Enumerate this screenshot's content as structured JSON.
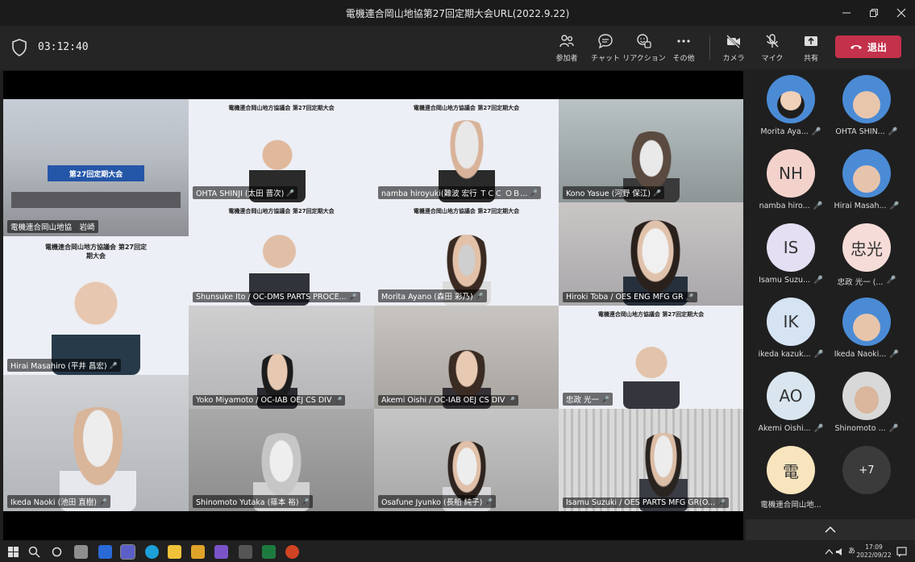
{
  "window": {
    "title": "電機連合岡山地協第27回定期大会URL(2022.9.22)"
  },
  "toolbar": {
    "timer": "03:12:40",
    "buttons": {
      "participants": "参加者",
      "chat": "チャット",
      "reactions": "リアクション",
      "more": "その他",
      "camera": "カメラ",
      "mic": "マイク",
      "share": "共有"
    },
    "leave_label": "退出",
    "leave_color": "#c4314b"
  },
  "tiles": [
    {
      "name": "電機連合岡山地協　岩崎",
      "slide": ""
    },
    {
      "name": "OHTA SHINJI (太田 晋次)",
      "slide": "電機連合岡山地方協議会 第27回定期大会"
    },
    {
      "name": "namba hiroyuki(難波 宏行 ＴＣＣ ＯＢ...",
      "slide": "電機連合岡山地方協議会 第27回定期大会"
    },
    {
      "name": "Kono Yasue (河野 保江)",
      "slide": ""
    },
    {
      "name": "Hirai Masahiro (平井 昌宏)",
      "slide": "電機連合岡山地方協議会 第27回定期大会"
    },
    {
      "name": "Shunsuke Ito / OC-DMS PARTS PROCE...",
      "slide": "電機連合岡山地方協議会 第27回定期大会"
    },
    {
      "name": "Morita Ayano (森田 彩乃)",
      "slide": "電機連合岡山地方協議会 第27回定期大会"
    },
    {
      "name": "Hiroki Toba / OES ENG MFG GR",
      "slide": ""
    },
    {
      "name": "Yoko Miyamoto / OC-IAB OEJ CS DIV",
      "slide": ""
    },
    {
      "name": "Akemi Oishi / OC-IAB OEJ CS DIV",
      "slide": ""
    },
    {
      "name": "忠政 光一",
      "slide": "電機連合岡山地方協議会 第27回定期大会"
    },
    {
      "name": "Ikeda Naoki (池田 直樹)",
      "slide": ""
    },
    {
      "name": "Shinomoto Yutaka (篠本 裕)",
      "slide": ""
    },
    {
      "name": "Osafune Jyunko (長船 純子)",
      "slide": ""
    },
    {
      "name": "Isamu Suzuki / OES PARTS MFG GR(O...",
      "slide": ""
    }
  ],
  "stage_banner": "第27回定期大会",
  "participants": [
    {
      "name": "Morita Aya...",
      "initials": "",
      "color": "#4b8bd6",
      "photo": true
    },
    {
      "name": "OHTA SHIN...",
      "initials": "",
      "color": "#4b8bd6",
      "photo": true
    },
    {
      "name": "namba hiro...",
      "initials": "NH",
      "color": "#f3d2cc"
    },
    {
      "name": "Hirai Masah...",
      "initials": "",
      "color": "#4b8bd6",
      "photo": true
    },
    {
      "name": "Isamu Suzu...",
      "initials": "IS",
      "color": "#e4dff3"
    },
    {
      "name": "忠政 光一 (...",
      "initials": "忠光",
      "color": "#f6dcd8"
    },
    {
      "name": "ikeda kazuk...",
      "initials": "IK",
      "color": "#d5e3f3"
    },
    {
      "name": "Ikeda Naoki...",
      "initials": "",
      "color": "#4b8bd6",
      "photo": true
    },
    {
      "name": "Akemi Oishi...",
      "initials": "AO",
      "color": "#d9e6ef"
    },
    {
      "name": "Shinomoto ...",
      "initials": "",
      "color": "#d8d8d8",
      "photo": true
    },
    {
      "name": "電機連合岡山地...",
      "initials": "電",
      "color": "#f8e5bd"
    }
  ],
  "more_count": "+7",
  "taskbar": {
    "tray_ime": "あ",
    "time": "17:09",
    "date": "2022/09/22"
  }
}
